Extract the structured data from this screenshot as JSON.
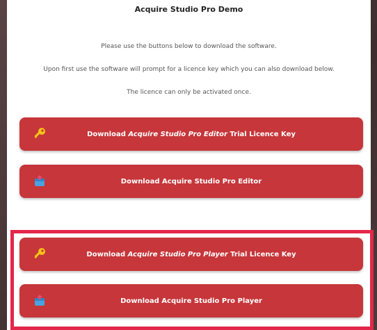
{
  "page": {
    "title": "Acquire Studio Pro Demo",
    "line1": "Please use the buttons below to download the software.",
    "line2": "Upon first use the software will prompt for a licence key which you can also download below.",
    "line3": "The licence can only be activated once."
  },
  "buttons": [
    {
      "icon": "key-icon",
      "prefix": "Download ",
      "emphasis": "Acquire Studio Pro Editor",
      "suffix": " Trial Licence Key"
    },
    {
      "icon": "installer-package-icon",
      "prefix": "Download Acquire Studio Pro Editor",
      "emphasis": "",
      "suffix": ""
    },
    {
      "icon": "key-icon",
      "prefix": "Download ",
      "emphasis": "Acquire Studio Pro Player",
      "suffix": " Trial Licence Key"
    },
    {
      "icon": "installer-package-icon",
      "prefix": "Download Acquire Studio Pro Player",
      "emphasis": "",
      "suffix": ""
    }
  ],
  "colors": {
    "button": "#c6363a",
    "highlight_border": "#e3274a",
    "key_icon": "#f5c416"
  }
}
